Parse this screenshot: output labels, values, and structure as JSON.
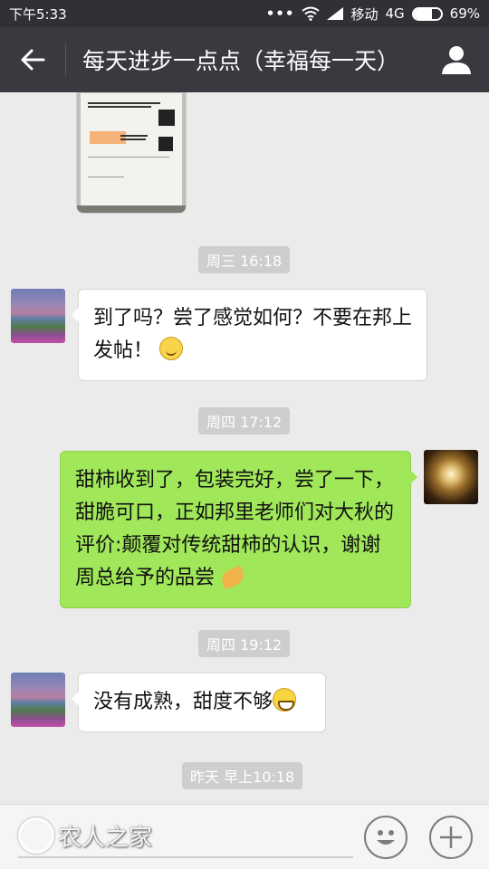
{
  "status": {
    "time": "下午5:33",
    "carrier": "移动",
    "network": "4G",
    "battery": "69%",
    "battery_fraction": 0.69
  },
  "header": {
    "title": "每天进步一点点（幸福每一天）"
  },
  "messages": {
    "t1": "周三 16:18",
    "m1": "到了吗？尝了感觉如何？不要在邦上发帖！",
    "t2": "周四 17:12",
    "m2": "甜柿收到了，包装完好，尝了一下，甜脆可口，正如邦里老师们对大秋的评价:颠覆对传统甜柿的认识，谢谢周总给予的品尝",
    "t3": "周四 19:12",
    "m3": "没有成熟，甜度不够",
    "t4": "昨天 早上10:18"
  },
  "footer": {
    "watermark": "农人之家"
  },
  "icons": {
    "back": "back-arrow-icon",
    "profile": "person-icon",
    "emoji": "emoji-icon",
    "plus": "plus-icon"
  }
}
